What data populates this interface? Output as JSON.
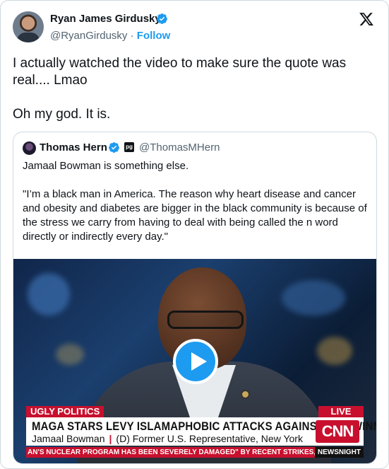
{
  "author": {
    "name": "Ryan James Girdusky",
    "handle": "@RyanGirdusky",
    "separator": "·",
    "follow_label": "Follow"
  },
  "icons": {
    "verified": "verified-badge-icon",
    "x_logo": "x-logo-icon",
    "affiliate": "pg-affiliate-badge-icon",
    "play": "play-icon"
  },
  "tweet": {
    "text": "I actually watched the video to make sure the quote was real.... Lmao\n\nOh my god. It is."
  },
  "quote": {
    "name": "Thomas Hern",
    "affiliate_label": "pg",
    "handle": "@ThomasMHern",
    "text": "Jamaal Bowman is something else.\n\n\"I’m a black man in America. The reason why heart disease and cancer and obesity and diabetes are bigger in the black community is because of the stress we carry from having to deal with being called the n word directly or indirectly every day.\""
  },
  "video": {
    "tag": "UGLY POLITICS",
    "live": "LIVE",
    "headline": "MAGA STARS LEVY ISLAMAPHOBIC ATTACKS AGAINST NYC WINNER",
    "sub_name": "Jamaal Bowman",
    "sub_sep": "|",
    "sub_desc": "(D) Former U.S. Representative, New York",
    "network": "CNN",
    "ticker": "AN'S NUCLEAR PROGRAM HAS BEEN SEVERELY DAMAGED\" BY RECENT STRIKES, UNDER",
    "ticker_brand": "NEWSNIGHT"
  },
  "colors": {
    "accent": "#1d9bf0",
    "text": "#0f1419",
    "muted": "#536471",
    "cnn_red": "#c8102e"
  }
}
